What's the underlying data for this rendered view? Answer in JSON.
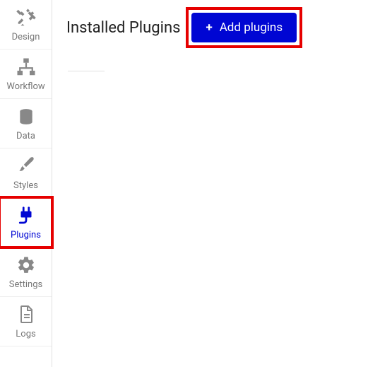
{
  "sidebar": {
    "items": [
      {
        "label": "Design"
      },
      {
        "label": "Workflow"
      },
      {
        "label": "Data"
      },
      {
        "label": "Styles"
      },
      {
        "label": "Plugins"
      },
      {
        "label": "Settings"
      },
      {
        "label": "Logs"
      }
    ]
  },
  "main": {
    "title": "Installed Plugins",
    "add_button_label": "Add plugins"
  },
  "colors": {
    "accent": "#0006d3",
    "highlight": "#e60000"
  }
}
